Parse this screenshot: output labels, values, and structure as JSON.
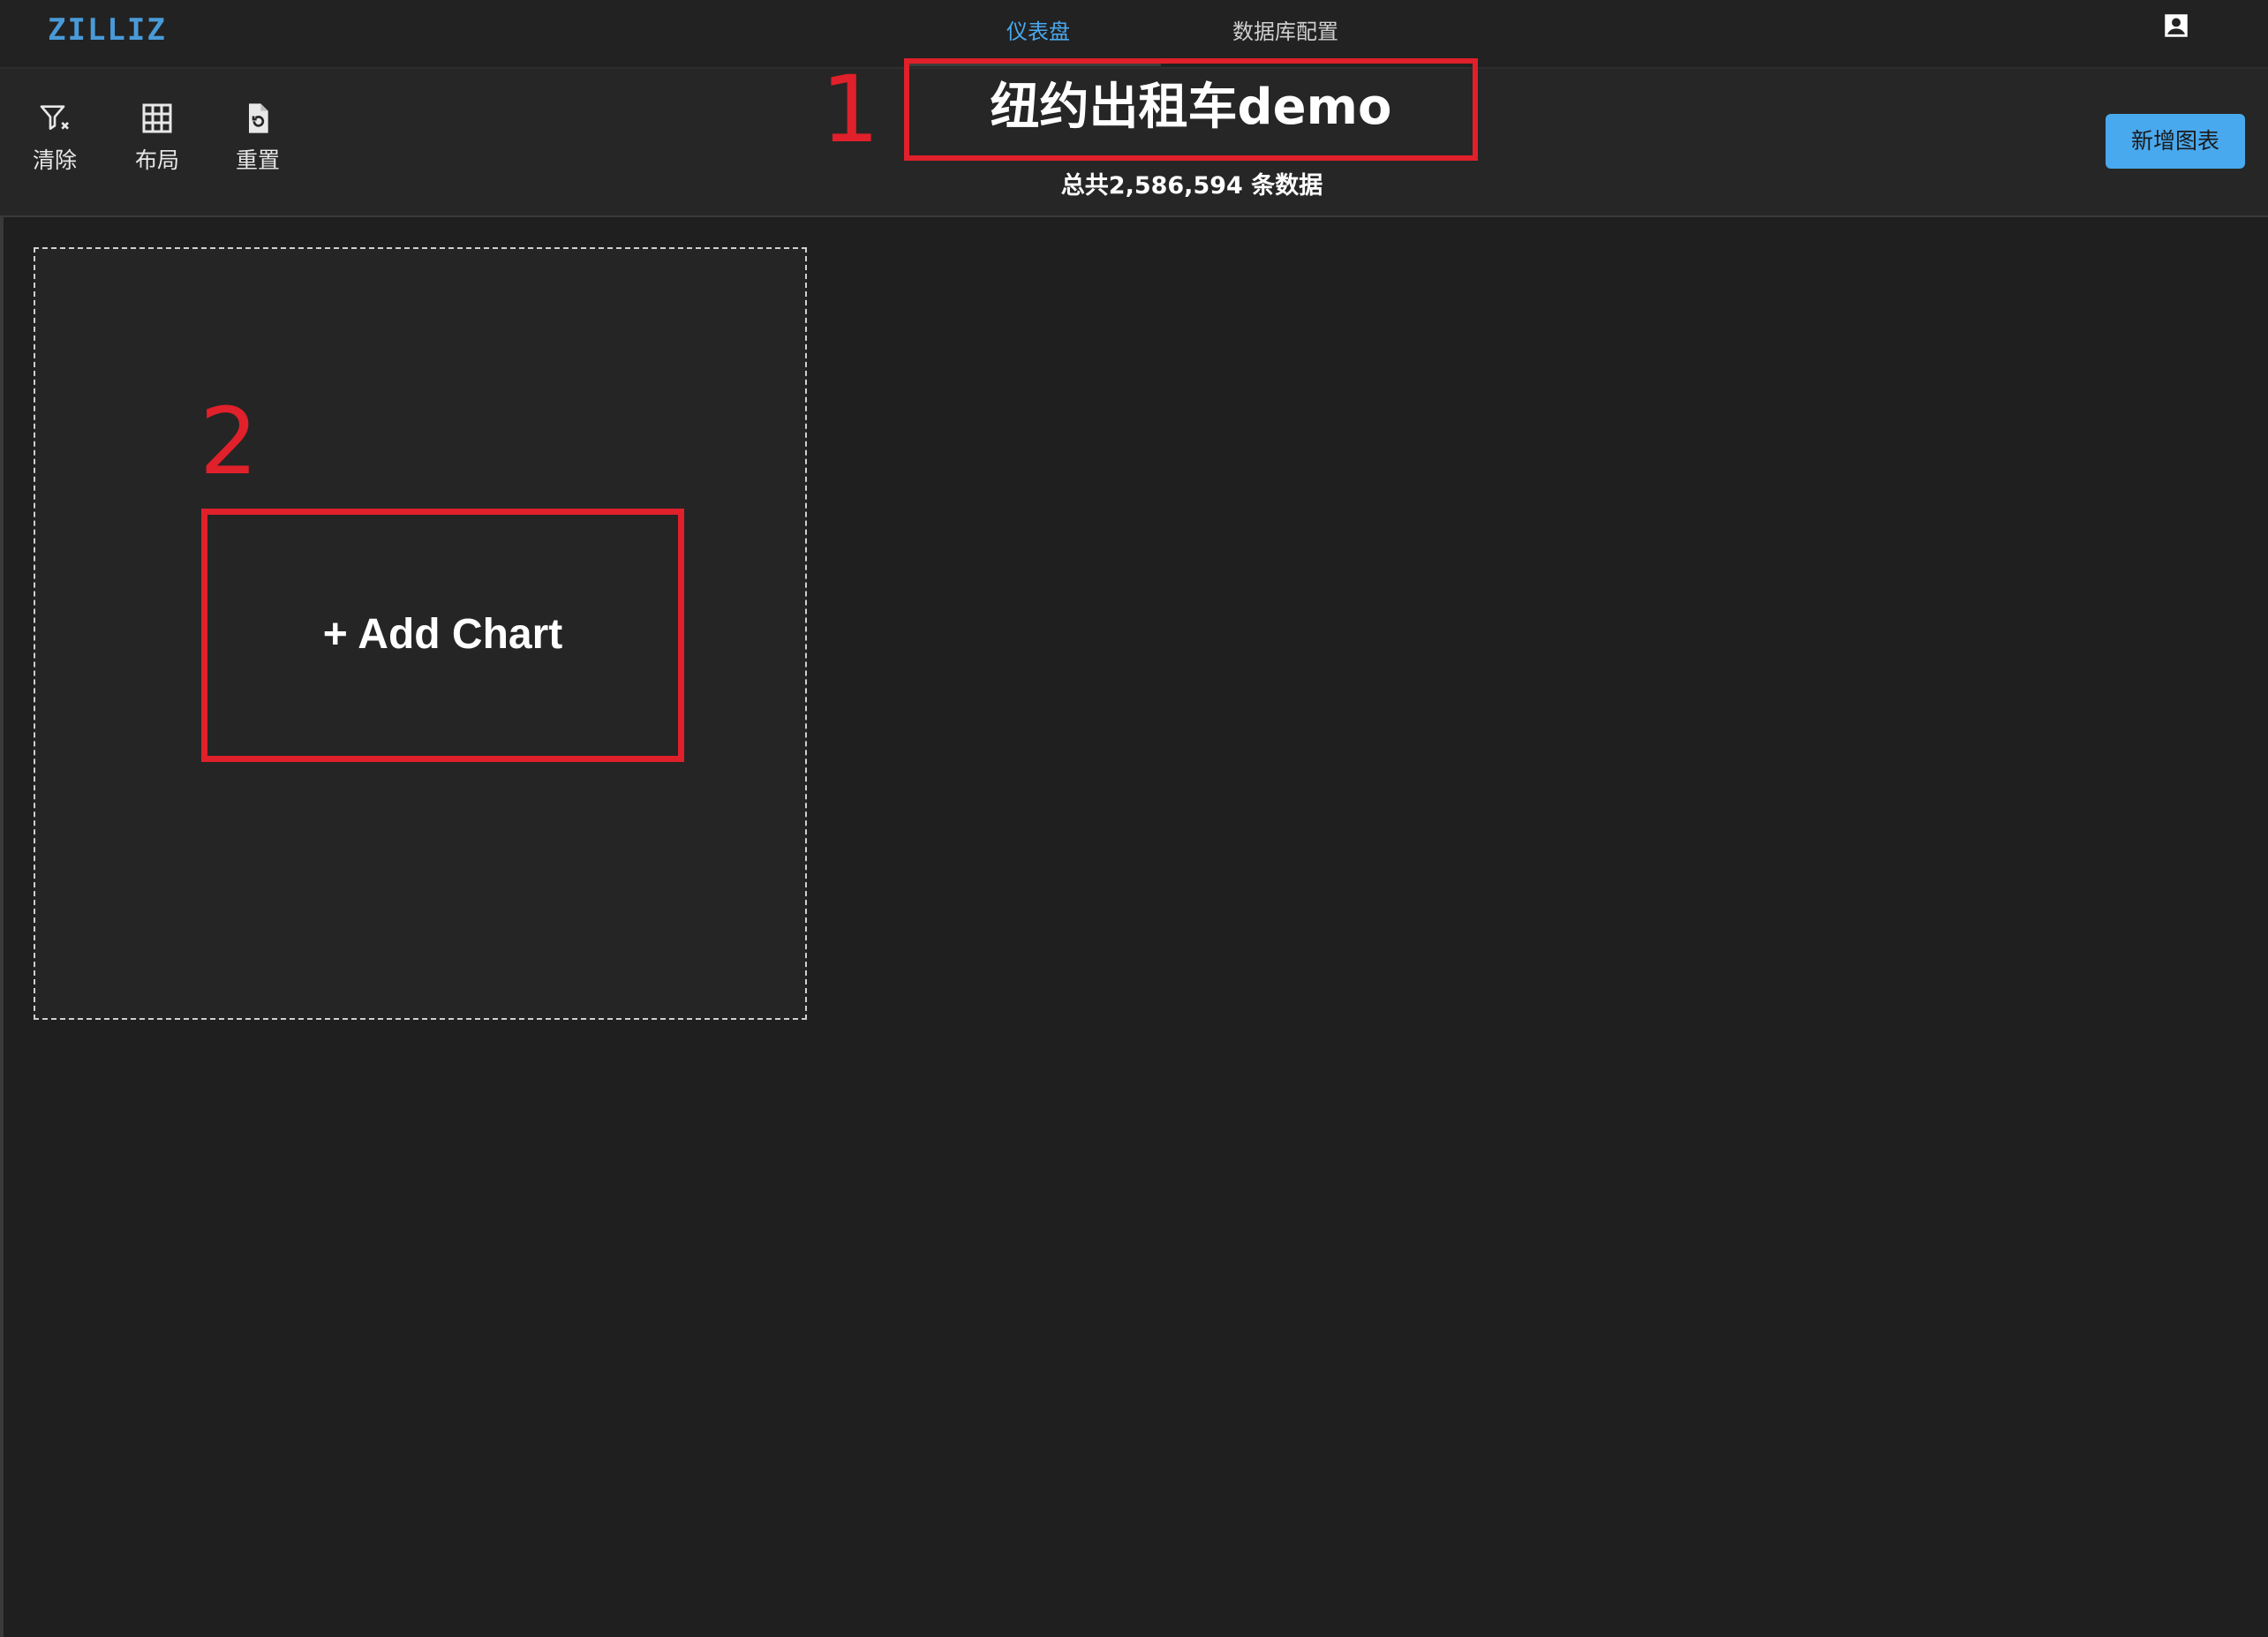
{
  "app": {
    "logo": "ZILLIZ"
  },
  "nav": {
    "tabs": [
      {
        "label": "仪表盘",
        "active": true
      },
      {
        "label": "数据库配置",
        "active": false
      }
    ],
    "user_icon": "account-box-icon"
  },
  "toolbar": {
    "tools": [
      {
        "label": "清除",
        "icon": "filter-clear-icon"
      },
      {
        "label": "布局",
        "icon": "grid-layout-icon"
      },
      {
        "label": "重置",
        "icon": "reset-file-icon"
      }
    ],
    "add_chart_button": "新增图表"
  },
  "dashboard": {
    "title": "纽约出租车demo",
    "subtitle": "总共2,586,594 条数据"
  },
  "placeholder": {
    "add_chart_label": "+ Add Chart"
  },
  "annotations": {
    "marker_1": "1",
    "marker_2": "2"
  },
  "colors": {
    "accent": "#49a9ee",
    "logo": "#4a9ad8",
    "annotation": "#e0202a",
    "background": "#1f1f1f"
  }
}
